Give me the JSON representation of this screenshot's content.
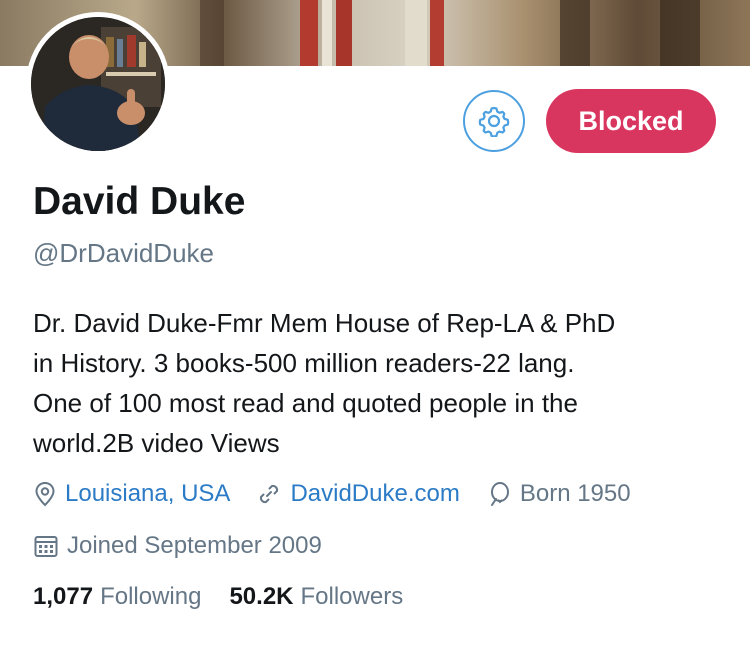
{
  "profile": {
    "display_name": "David Duke",
    "handle": "@DrDavidDuke",
    "bio_lines": [
      "Dr. David Duke-Fmr Mem House of Rep-LA & PhD",
      "in History. 3 books-500 million readers-22 lang.",
      "One of 100 most read and quoted people in the",
      "world.2B video Views"
    ],
    "location": "Louisiana, USA",
    "website": "DavidDuke.com",
    "born": "Born 1950",
    "joined": "Joined September 2009"
  },
  "actions": {
    "blocked_label": "Blocked",
    "settings_icon": "gear-icon"
  },
  "stats": {
    "following_count": "1,077",
    "following_label": "Following",
    "followers_count": "50.2K",
    "followers_label": "Followers"
  },
  "colors": {
    "accent_blue": "#2b7bc6",
    "blocked_red": "#d9365f",
    "secondary_text": "#657786"
  }
}
